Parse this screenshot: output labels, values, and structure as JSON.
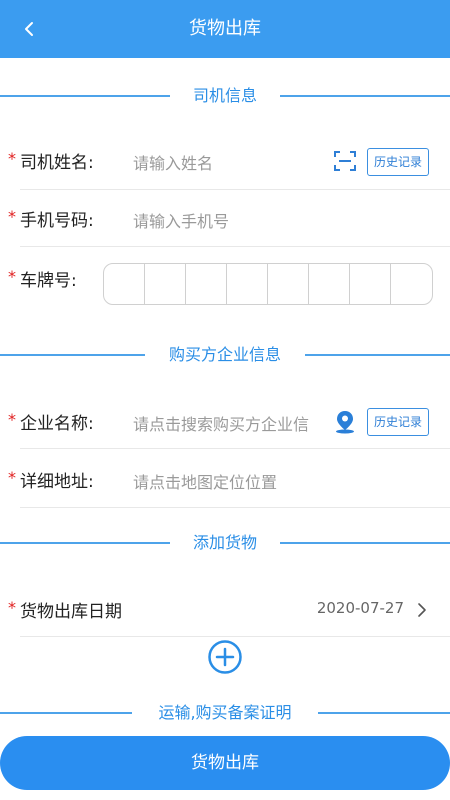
{
  "header": {
    "title": "货物出库"
  },
  "sections": {
    "driver": "司机信息",
    "buyer": "购买方企业信息",
    "goods": "添加货物",
    "certificate": "运输,购买备案证明"
  },
  "driver": {
    "name_star": "*",
    "name_label": "司机姓名:",
    "name_placeholder": "请输入姓名",
    "history_label": "历史记录",
    "phone_star": "*",
    "phone_label": "手机号码:",
    "phone_placeholder": "请输入手机号",
    "plate_star": "*",
    "plate_label": "车牌号:"
  },
  "buyer": {
    "company_star": "*",
    "company_label": "企业名称:",
    "company_placeholder": "请点击搜索购买方企业信",
    "history_label": "历史记录",
    "address_star": "*",
    "address_label": "详细地址:",
    "address_placeholder": "请点击地图定位位置"
  },
  "goods": {
    "date_star": "*",
    "date_label": "货物出库日期",
    "date_value": "2020-07-27"
  },
  "footer": {
    "submit_label": "货物出库"
  }
}
